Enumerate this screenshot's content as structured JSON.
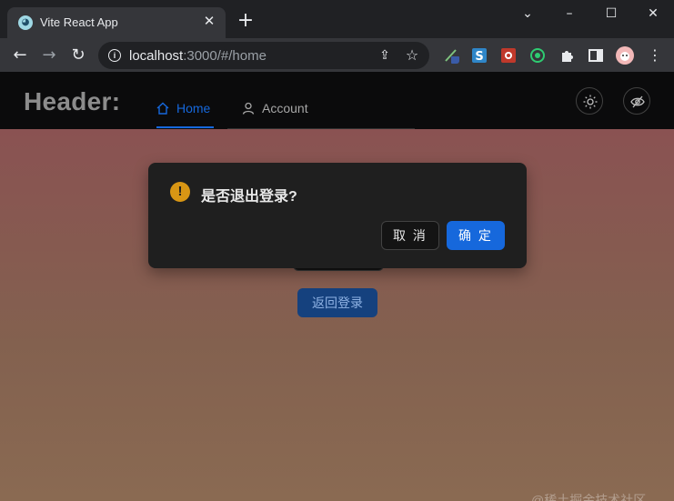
{
  "browser": {
    "tab_title": "Vite React App",
    "favicon_icon": "vite-favicon-icon",
    "url_host": "localhost",
    "url_rest": ":3000/#/home",
    "extensions": [
      "pen-extension-icon",
      "s-extension-icon",
      "red-extension-icon",
      "circle-extension-icon",
      "puzzle-icon",
      "sidepanel-icon",
      "profile-avatar"
    ]
  },
  "app": {
    "brand": "Header:",
    "nav": [
      {
        "label": "Home",
        "icon": "home-icon",
        "active": true
      },
      {
        "label": "Account",
        "icon": "user-icon",
        "active": false
      }
    ],
    "theme_icon": "sun-icon",
    "toggle_icon": "eye-slash-icon",
    "back_login_label": "返回登录",
    "accent_color": "#1668dc"
  },
  "dialog": {
    "icon": "exclamation-circle-icon",
    "title": "是否退出登录?",
    "cancel_label": "取 消",
    "ok_label": "确 定"
  },
  "watermark": "@稀土掘金技术社区"
}
